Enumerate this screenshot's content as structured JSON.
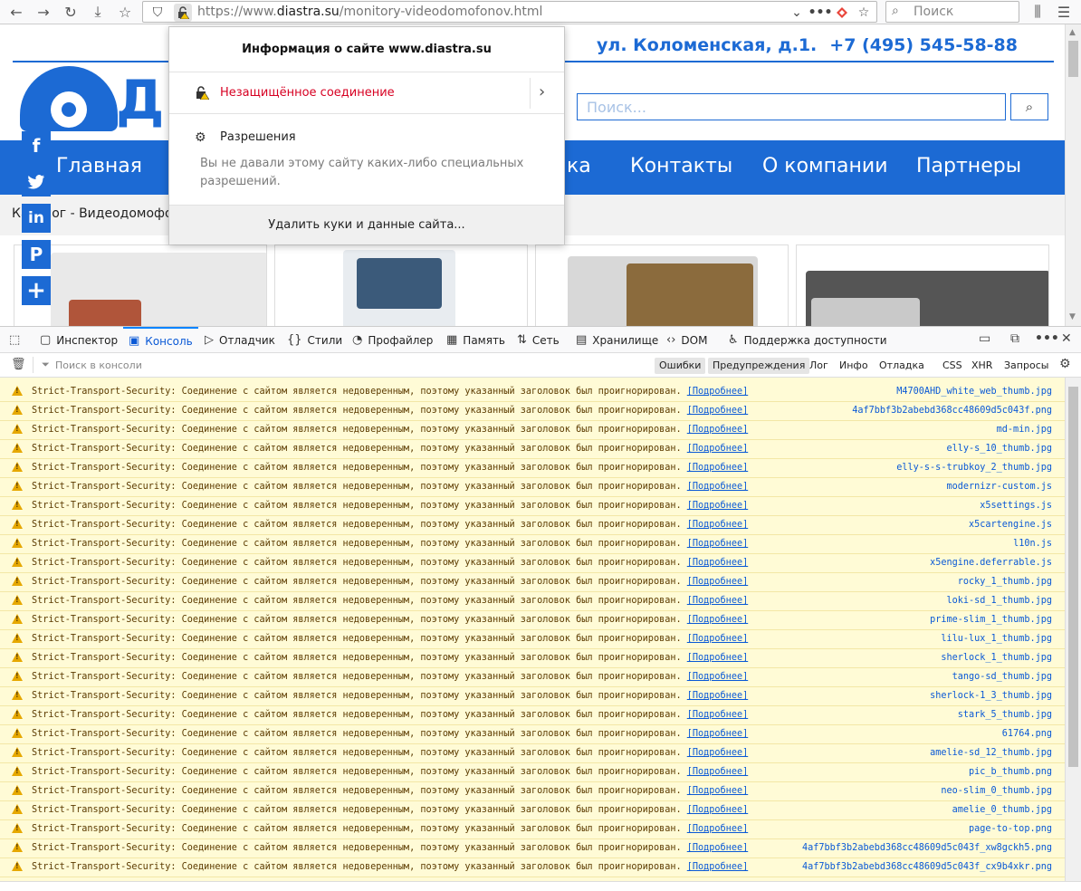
{
  "browser": {
    "url_prefix": "https://www.",
    "url_domain": "diastra.su",
    "url_path": "/monitory-videodomofonov.html",
    "search_placeholder": "Поиск"
  },
  "site": {
    "address": "ул. Коломенская, д.1.",
    "phone": "+7 (495) 545-58-88",
    "logo_text": "ДИ",
    "search_placeholder": "Поиск...",
    "nav": [
      "Главная",
      "ка",
      "Контакты",
      "О компании",
      "Партнеры"
    ],
    "breadcrumb": "Каталог - Видеодомофо"
  },
  "popup": {
    "title": "Информация о сайте www.diastra.su",
    "insecure_label": "Незащищённое соединение",
    "permissions_title": "Разрешения",
    "permissions_desc": "Вы не давали этому сайту каких-либо специальных разрешений.",
    "clear_button": "Удалить куки и данные сайта..."
  },
  "devtools": {
    "tabs": [
      "Инспектор",
      "Консоль",
      "Отладчик",
      "Стили",
      "Профайлер",
      "Память",
      "Сеть",
      "Хранилище",
      "DOM",
      "Поддержка доступности"
    ],
    "active_tab": "Консоль",
    "filter_placeholder": "Поиск в консоли",
    "filters": [
      "Ошибки",
      "Предупреждения",
      "Лог",
      "Инфо",
      "Отладка",
      "CSS",
      "XHR",
      "Запросы"
    ],
    "filters_active": [
      "Ошибки",
      "Предупреждения"
    ]
  },
  "console": {
    "message": "Strict-Transport-Security: Соединение с сайтом является недоверенным, поэтому указанный заголовок был проигнорирован.",
    "more_link": "[Подробнее]",
    "sources": [
      "M4700AHD_white_web_thumb.jpg",
      "4af7bbf3b2abebd368cc48609d5c043f.png",
      "md-min.jpg",
      "elly-s_10_thumb.jpg",
      "elly-s-s-trubkoy_2_thumb.jpg",
      "modernizr-custom.js",
      "x5settings.js",
      "x5cartengine.js",
      "l10n.js",
      "x5engine.deferrable.js",
      "rocky_1_thumb.jpg",
      "loki-sd_1_thumb.jpg",
      "prime-slim_1_thumb.jpg",
      "lilu-lux_1_thumb.jpg",
      "sherlock_1_thumb.jpg",
      "tango-sd_thumb.jpg",
      "sherlock-1_3_thumb.jpg",
      "stark_5_thumb.jpg",
      "61764.png",
      "amelie-sd_12_thumb.jpg",
      "pic_b_thumb.png",
      "neo-slim_0_thumb.jpg",
      "amelie_0_thumb.jpg",
      "page-to-top.png",
      "4af7bbf3b2abebd368cc48609d5c043f_xw8gckh5.png",
      "4af7bbf3b2abebd368cc48609d5c043f_cx9b4xkr.png"
    ]
  }
}
